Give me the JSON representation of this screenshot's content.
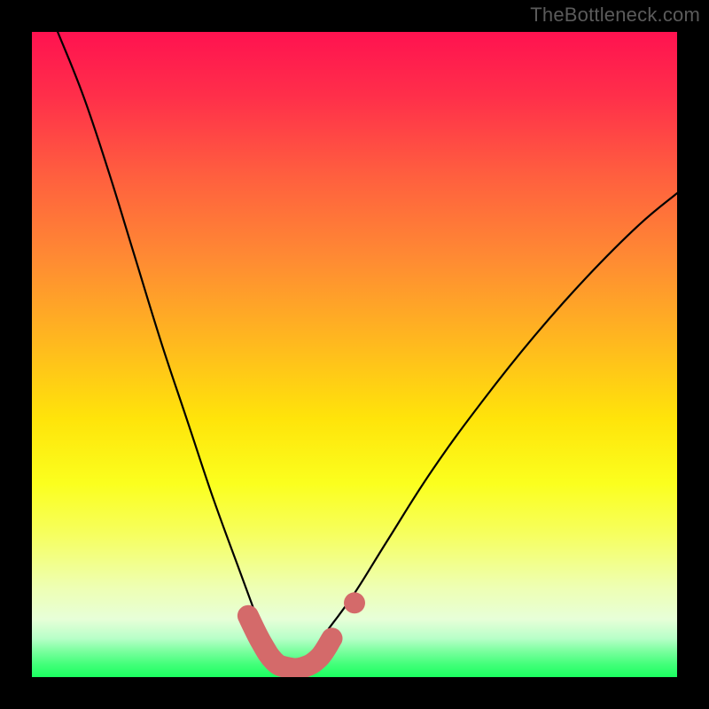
{
  "watermark": {
    "text": "TheBottleneck.com"
  },
  "chart_data": {
    "type": "line",
    "title": "",
    "xlabel": "",
    "ylabel": "",
    "xlim": [
      0,
      1
    ],
    "ylim": [
      0,
      1
    ],
    "gradient_stops": [
      {
        "pos": 0.0,
        "label": "red-pink"
      },
      {
        "pos": 0.5,
        "label": "orange"
      },
      {
        "pos": 0.7,
        "label": "yellow"
      },
      {
        "pos": 0.9,
        "label": "pale-yellow"
      },
      {
        "pos": 1.0,
        "label": "green"
      }
    ],
    "series": [
      {
        "name": "left-curve",
        "color": "#000000",
        "points": [
          {
            "x": 0.04,
            "y": 1.0
          },
          {
            "x": 0.08,
            "y": 0.9
          },
          {
            "x": 0.12,
            "y": 0.78
          },
          {
            "x": 0.16,
            "y": 0.65
          },
          {
            "x": 0.2,
            "y": 0.52
          },
          {
            "x": 0.24,
            "y": 0.4
          },
          {
            "x": 0.28,
            "y": 0.28
          },
          {
            "x": 0.32,
            "y": 0.17
          },
          {
            "x": 0.355,
            "y": 0.075
          }
        ]
      },
      {
        "name": "right-curve",
        "color": "#000000",
        "points": [
          {
            "x": 0.46,
            "y": 0.075
          },
          {
            "x": 0.5,
            "y": 0.13
          },
          {
            "x": 0.55,
            "y": 0.21
          },
          {
            "x": 0.62,
            "y": 0.32
          },
          {
            "x": 0.7,
            "y": 0.43
          },
          {
            "x": 0.78,
            "y": 0.53
          },
          {
            "x": 0.86,
            "y": 0.62
          },
          {
            "x": 0.94,
            "y": 0.7
          },
          {
            "x": 1.0,
            "y": 0.75
          }
        ]
      },
      {
        "name": "trough-marker",
        "color": "#d46a6a",
        "points": [
          {
            "x": 0.335,
            "y": 0.095
          },
          {
            "x": 0.355,
            "y": 0.055
          },
          {
            "x": 0.375,
            "y": 0.025
          },
          {
            "x": 0.395,
            "y": 0.015
          },
          {
            "x": 0.42,
            "y": 0.015
          },
          {
            "x": 0.445,
            "y": 0.03
          },
          {
            "x": 0.465,
            "y": 0.06
          }
        ]
      },
      {
        "name": "trough-dot",
        "color": "#d46a6a",
        "points": [
          {
            "x": 0.5,
            "y": 0.115
          }
        ]
      }
    ]
  }
}
